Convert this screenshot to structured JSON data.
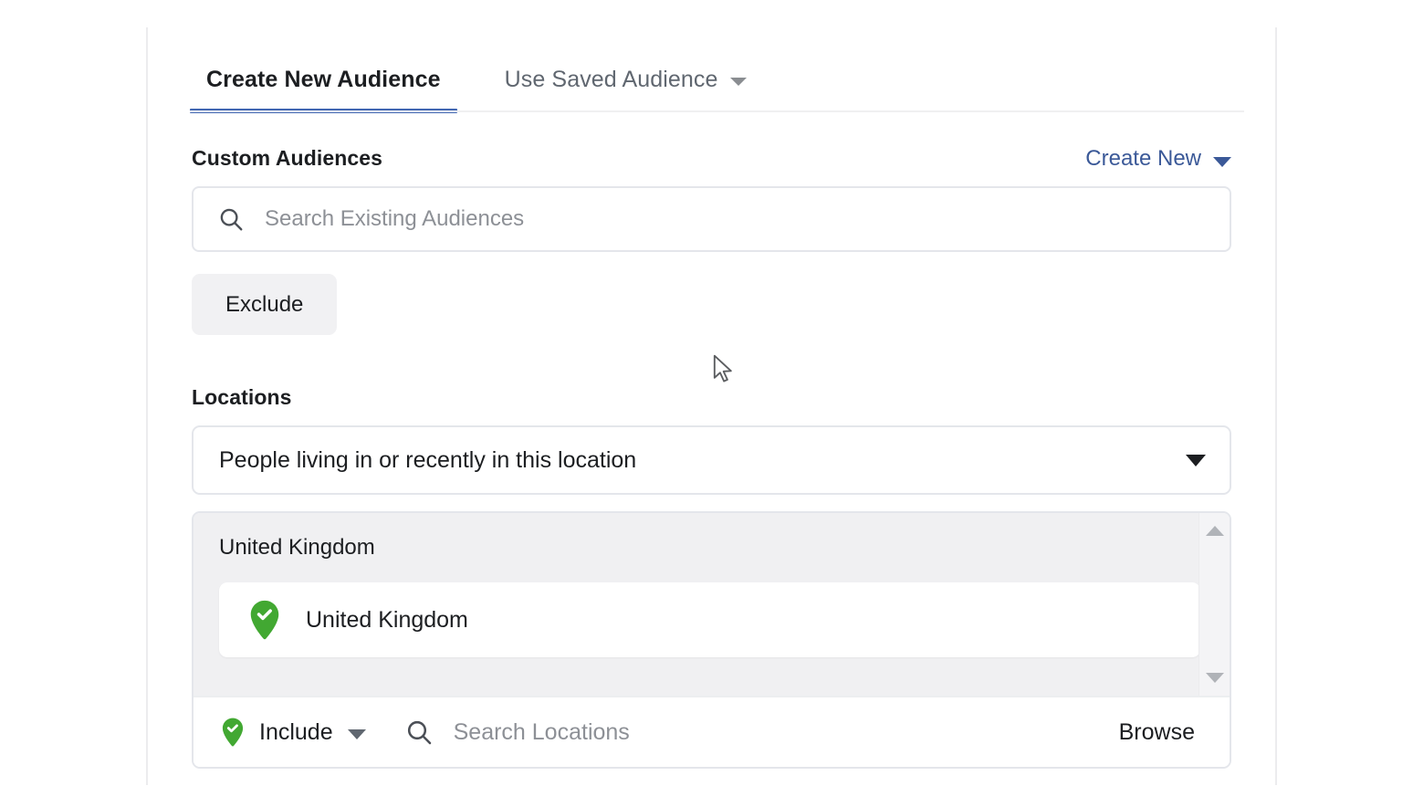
{
  "tabs": [
    {
      "label": "Create New Audience",
      "active": true,
      "has_caret": false
    },
    {
      "label": "Use Saved Audience",
      "active": false,
      "has_caret": true
    }
  ],
  "custom_audiences": {
    "title": "Custom Audiences",
    "create_new_label": "Create New",
    "search_placeholder": "Search Existing Audiences",
    "exclude_label": "Exclude"
  },
  "locations": {
    "title": "Locations",
    "selected_scope": "People living in or recently in this location",
    "group_label": "United Kingdom",
    "items": [
      {
        "label": "United Kingdom",
        "state": "included"
      }
    ],
    "include_label": "Include",
    "search_placeholder": "Search Locations",
    "browse_label": "Browse"
  },
  "colors": {
    "accent_blue": "#4267b2",
    "link_blue": "#3b5998",
    "include_green": "#42a832",
    "panel_gray": "#f0f0f2",
    "text_primary": "#1c1e21",
    "text_muted": "#8d9096"
  },
  "icons": {
    "search": "search-icon",
    "caret_down": "chevron-down-icon",
    "map_pin_check": "map-pin-check-icon",
    "scroll_up": "scroll-up-arrow-icon",
    "scroll_down": "scroll-down-arrow-icon",
    "cursor": "mouse-pointer-icon"
  }
}
